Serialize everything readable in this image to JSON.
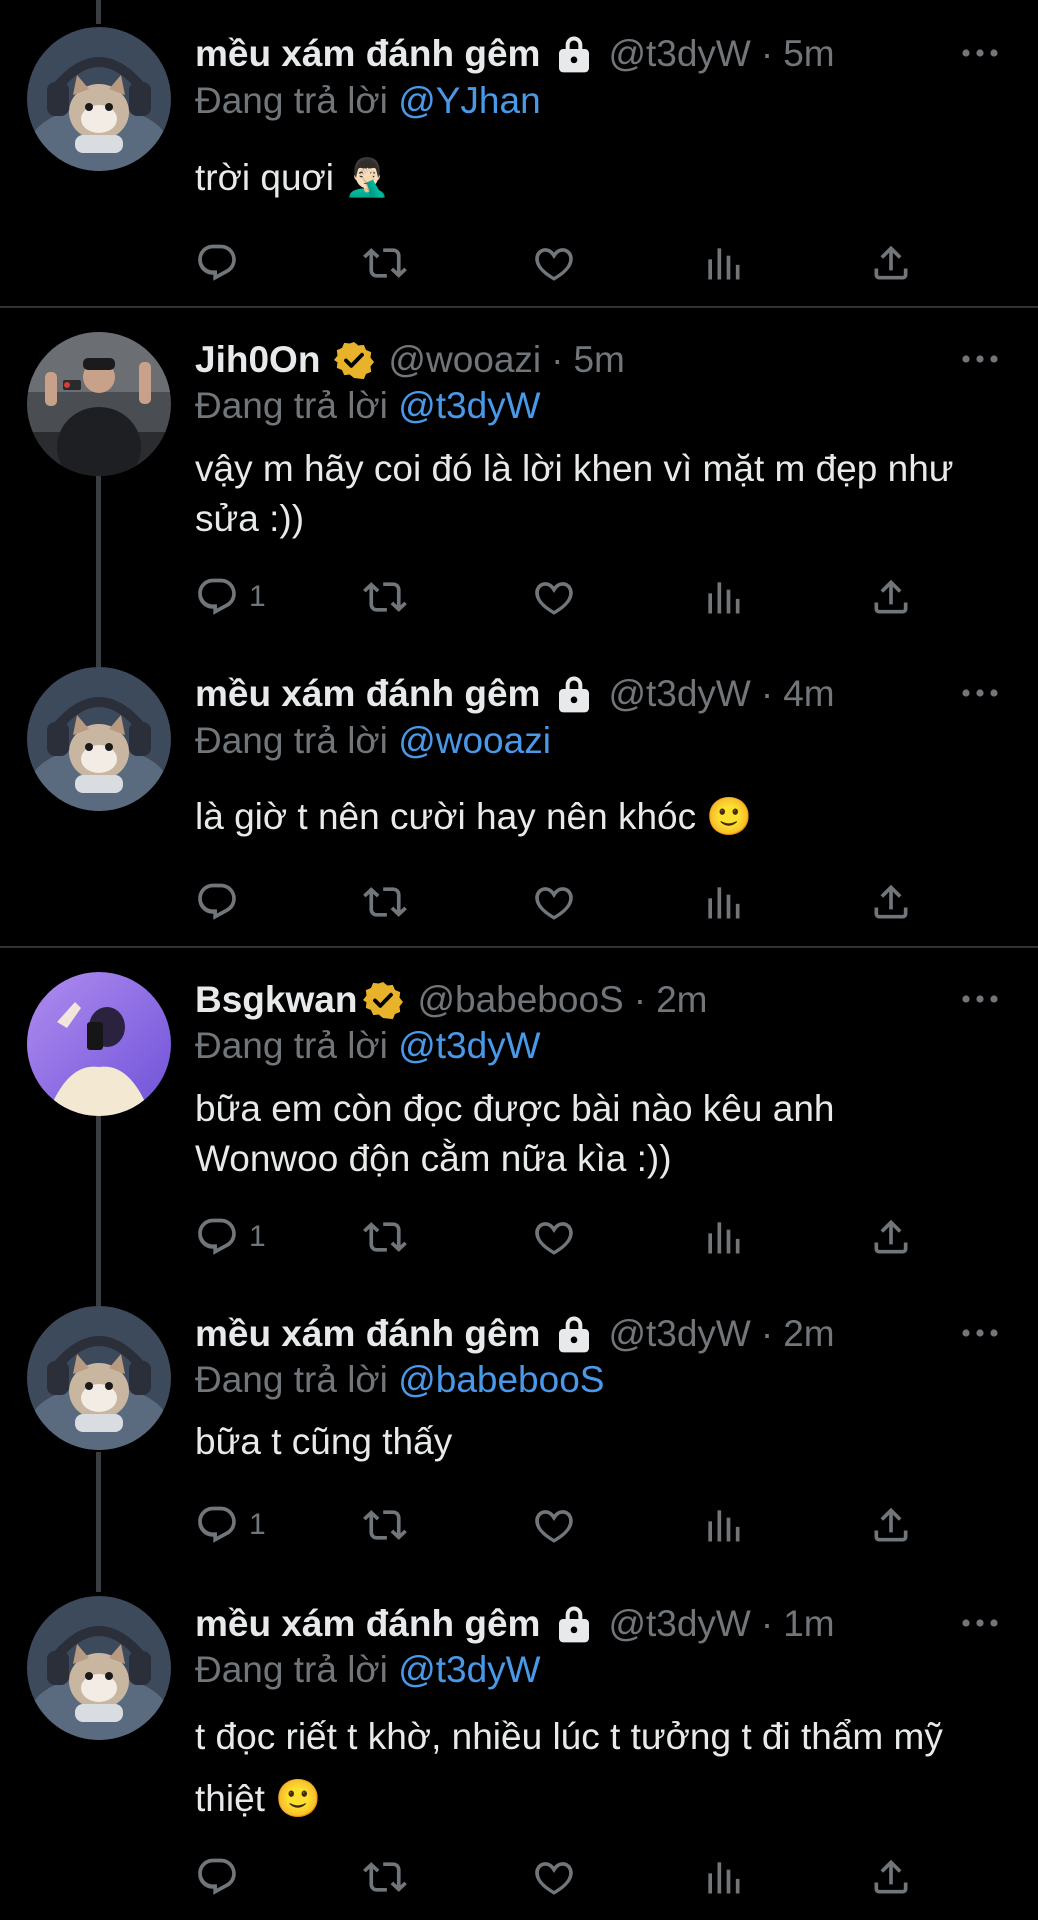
{
  "colors": {
    "background": "#000000",
    "text": "#e7e9ea",
    "secondary": "#71767b",
    "mention": "#4a99e9",
    "verified": "#e8b32a",
    "thread_line": "#3a3d41"
  },
  "tweets": [
    {
      "display_name": "mều xám đánh gêm",
      "badge": "lock-icon",
      "handle": "@t3dyW",
      "separator": "·",
      "time": "5m",
      "reply_prefix": "Đang trả lời",
      "reply_to": "@YJhan",
      "text": "trời quơi 🤦🏻‍♂️",
      "reply_count": ""
    },
    {
      "display_name": "Jih0On",
      "badge": "verified-icon",
      "handle": "@wooazi",
      "separator": "·",
      "time": "5m",
      "reply_prefix": "Đang trả lời",
      "reply_to": "@t3dyW",
      "text": "vậy m hãy coi đó là lời khen vì mặt m đẹp như sửa :))",
      "reply_count": "1"
    },
    {
      "display_name": "mều xám đánh gêm",
      "badge": "lock-icon",
      "handle": "@t3dyW",
      "separator": "·",
      "time": "4m",
      "reply_prefix": "Đang trả lời",
      "reply_to": "@wooazi",
      "text": "là giờ t nên cười hay nên khóc 🙂",
      "reply_count": ""
    },
    {
      "display_name": "Bsgkwan",
      "badge": "verified-icon",
      "handle": "@babebooS",
      "separator": "·",
      "time": "2m",
      "reply_prefix": "Đang trả lời",
      "reply_to": "@t3dyW",
      "text": "bữa em còn đọc được bài nào kêu anh Wonwoo độn cằm nữa kìa :))",
      "reply_count": "1"
    },
    {
      "display_name": "mều xám đánh gêm",
      "badge": "lock-icon",
      "handle": "@t3dyW",
      "separator": "·",
      "time": "2m",
      "reply_prefix": "Đang trả lời",
      "reply_to": "@babebooS",
      "text": "bữa t cũng thấy",
      "reply_count": "1"
    },
    {
      "display_name": "mều xám đánh gêm",
      "badge": "lock-icon",
      "handle": "@t3dyW",
      "separator": "·",
      "time": "1m",
      "reply_prefix": "Đang trả lời",
      "reply_to": "@t3dyW",
      "text": "t đọc riết t khờ, nhiều lúc t tưởng t đi thẩm mỹ thiệt 🙂",
      "reply_count": ""
    }
  ]
}
